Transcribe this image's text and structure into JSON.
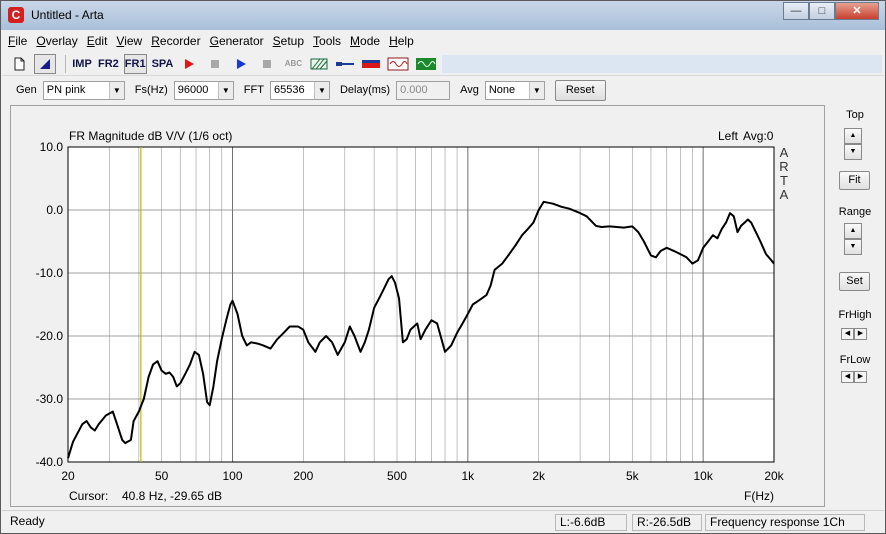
{
  "window": {
    "title": "Untitled - Arta"
  },
  "menu": [
    "File",
    "Overlay",
    "Edit",
    "View",
    "Recorder",
    "Generator",
    "Setup",
    "Tools",
    "Mode",
    "Help"
  ],
  "toolbar": {
    "imp_label": "IMP",
    "fr2_label": "FR2",
    "fr1_label": "FR1",
    "spa_label": "SPA",
    "abc_label": "ABC"
  },
  "params": {
    "gen_label": "Gen",
    "gen_value": "PN pink",
    "fs_label": "Fs(Hz)",
    "fs_value": "96000",
    "fft_label": "FFT",
    "fft_value": "65536",
    "delay_label": "Delay(ms)",
    "delay_value": "0.000",
    "avg_label": "Avg",
    "avg_value": "None",
    "reset_label": "Reset"
  },
  "plot": {
    "title": "FR Magnitude dB V/V (1/6 oct)",
    "channel": "Left",
    "avg": "Avg:0",
    "logo": [
      "A",
      "R",
      "T",
      "A"
    ],
    "cursor_label": "Cursor:",
    "cursor_value": "40.8 Hz, -29.65 dB",
    "cursor_freq": 40.8,
    "xaxis_label": "F(Hz)",
    "colors": {
      "curve": "#000000",
      "cursor": "#c8b400",
      "grid": "#a8a8a8",
      "background": "#ffffff"
    }
  },
  "chart_data": {
    "type": "line",
    "title": "FR Magnitude dB V/V (1/6 oct)",
    "xlabel": "F(Hz)",
    "ylabel": "",
    "xscale": "log",
    "xlim": [
      20,
      20000
    ],
    "ylim": [
      -40,
      10
    ],
    "xticks": [
      {
        "v": 20,
        "label": "20"
      },
      {
        "v": 50,
        "label": "50"
      },
      {
        "v": 100,
        "label": "100"
      },
      {
        "v": 200,
        "label": "200"
      },
      {
        "v": 500,
        "label": "500"
      },
      {
        "v": 1000,
        "label": "1k"
      },
      {
        "v": 2000,
        "label": "2k"
      },
      {
        "v": 5000,
        "label": "5k"
      },
      {
        "v": 10000,
        "label": "10k"
      },
      {
        "v": 20000,
        "label": "20k"
      }
    ],
    "yticks": [
      {
        "v": 10,
        "label": "10.0"
      },
      {
        "v": 0,
        "label": "0.0"
      },
      {
        "v": -10,
        "label": "-10.0"
      },
      {
        "v": -20,
        "label": "-20.0"
      },
      {
        "v": -30,
        "label": "-30.0"
      },
      {
        "v": -40,
        "label": "-40.0"
      }
    ],
    "grid": true,
    "series": [
      {
        "x": [
          20,
          21,
          23,
          24,
          25,
          26,
          27,
          29,
          31,
          32,
          34,
          35,
          37,
          38,
          40,
          42,
          44,
          46,
          48,
          50,
          52,
          54,
          56,
          58,
          60,
          63,
          66,
          69,
          72,
          75,
          78,
          80,
          83,
          86,
          90,
          94,
          98,
          100,
          105,
          110,
          115,
          120,
          128,
          135,
          145,
          155,
          165,
          175,
          190,
          200,
          210,
          225,
          235,
          250,
          265,
          280,
          300,
          315,
          330,
          350,
          365,
          380,
          400,
          420,
          440,
          460,
          475,
          490,
          510,
          530,
          550,
          570,
          590,
          610,
          630,
          660,
          700,
          740,
          780,
          800,
          850,
          900,
          950,
          1000,
          1050,
          1100,
          1150,
          1200,
          1250,
          1300,
          1400,
          1500,
          1600,
          1700,
          1800,
          1900,
          2000,
          2100,
          2300,
          2500,
          2700,
          3000,
          3200,
          3500,
          3700,
          4000,
          4300,
          4600,
          5000,
          5300,
          5600,
          6000,
          6300,
          6600,
          7000,
          7500,
          8000,
          8500,
          9000,
          9500,
          10000,
          10500,
          11000,
          11500,
          12000,
          12500,
          13000,
          13500,
          14000,
          14500,
          15000,
          15500,
          16000,
          16500,
          17000,
          17500,
          18000,
          18500,
          19000,
          19500,
          20000
        ],
        "y": [
          -39.4,
          -36.8,
          -34.0,
          -33.5,
          -34.5,
          -35.0,
          -34.0,
          -32.6,
          -32.0,
          -33.5,
          -36.5,
          -37.0,
          -36.5,
          -33.5,
          -32.0,
          -30.0,
          -26.5,
          -24.5,
          -24.0,
          -25.5,
          -26.0,
          -25.8,
          -26.5,
          -28.0,
          -27.5,
          -26.0,
          -24.5,
          -22.5,
          -23.0,
          -26.0,
          -30.5,
          -31.0,
          -28.0,
          -24.0,
          -20.5,
          -17.5,
          -15.0,
          -14.4,
          -16.5,
          -20.0,
          -21.5,
          -21.0,
          -21.2,
          -21.5,
          -22.0,
          -20.5,
          -19.5,
          -18.5,
          -18.5,
          -19.0,
          -21.0,
          -22.5,
          -21.0,
          -20.0,
          -21.0,
          -23.0,
          -21.0,
          -18.5,
          -20.0,
          -22.5,
          -21.0,
          -19.0,
          -15.5,
          -14.0,
          -12.5,
          -11.0,
          -10.5,
          -11.5,
          -14.0,
          -21.0,
          -20.5,
          -19.0,
          -18.5,
          -18.0,
          -20.5,
          -19.0,
          -17.5,
          -18.0,
          -21.0,
          -22.5,
          -21.5,
          -19.5,
          -18.0,
          -16.5,
          -15.0,
          -14.5,
          -14.0,
          -13.5,
          -12.0,
          -9.5,
          -8.5,
          -7.0,
          -5.5,
          -4.0,
          -3.0,
          -2.0,
          0.0,
          1.3,
          1.0,
          0.5,
          0.2,
          -0.5,
          -1.0,
          -2.5,
          -2.7,
          -2.6,
          -2.7,
          -2.8,
          -2.6,
          -3.5,
          -5.0,
          -7.2,
          -7.5,
          -6.5,
          -6.0,
          -6.5,
          -7.0,
          -7.5,
          -8.5,
          -8.0,
          -6.0,
          -5.0,
          -4.0,
          -4.5,
          -3.0,
          -2.0,
          -0.5,
          -1.0,
          -3.5,
          -2.5,
          -2.0,
          -1.5,
          -2.0,
          -3.0,
          -4.0,
          -5.0,
          -6.0,
          -7.0,
          -7.5,
          -8.0,
          -8.5
        ]
      }
    ]
  },
  "side": {
    "top_label": "Top",
    "fit_label": "Fit",
    "range_label": "Range",
    "set_label": "Set",
    "frhigh_label": "FrHigh",
    "frlow_label": "FrLow"
  },
  "status": {
    "ready": "Ready",
    "left": "L:-6.6dB",
    "right": "R:-26.5dB",
    "mode": "Frequency response 1Ch"
  }
}
